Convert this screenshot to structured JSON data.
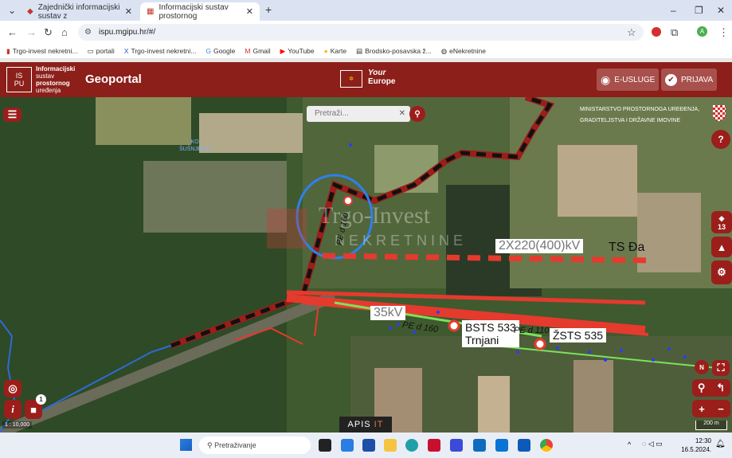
{
  "browser": {
    "tabs": [
      {
        "label": "Zajednički informacijski sustav z"
      },
      {
        "label": "Informacijski sustav prostornog"
      }
    ],
    "new_tab": "+",
    "url": "ispu.mgipu.hr/#/",
    "profile_initial": "A",
    "bookmarks": [
      "Trgo-invest nekretni...",
      "portali",
      "Trgo-invest nekretni...",
      "Google",
      "Gmail",
      "YouTube",
      "Karte",
      "Brodsko-posavska ž...",
      "eNekretnine"
    ]
  },
  "header": {
    "logo_lines": [
      "Informacijski",
      "sustav",
      "prostornog",
      "uređenja"
    ],
    "title": "Geoportal",
    "your_europe": [
      "Your",
      "Europe"
    ],
    "eusluge": "E-USLUGE",
    "prijava": "PRIJAVA"
  },
  "map": {
    "search_placeholder": "Pretraži...",
    "ministry": [
      "MINISTARSTVO PROSTORNOGA UREĐENJA,",
      "GRADITELJSTVA I DRŽAVNE IMOVINE"
    ],
    "ko_label": [
      "KO",
      "ŠUŠNJEVCI"
    ],
    "watermark": [
      "Trgo-Invest",
      "NEKRETNINE"
    ],
    "labels": {
      "kv400": "2X220(400)kV",
      "ts": "TS Đa",
      "kv35": "35kV",
      "bsts": [
        "BSTS 533",
        "Trnjani"
      ],
      "zsts": "ŽSTS 535",
      "pipe1": "PE d 160",
      "pipe2": "PE d 110",
      "vert": "PE d 160"
    },
    "layers_count": "13",
    "badge_count": "1",
    "scale": "1 : 10,000",
    "scalebar": "200 m",
    "apis": "APIS",
    "apis_it": "IT"
  },
  "taskbar": {
    "search": "Pretraživanje",
    "time": "12:30",
    "date": "16.5.2024."
  }
}
